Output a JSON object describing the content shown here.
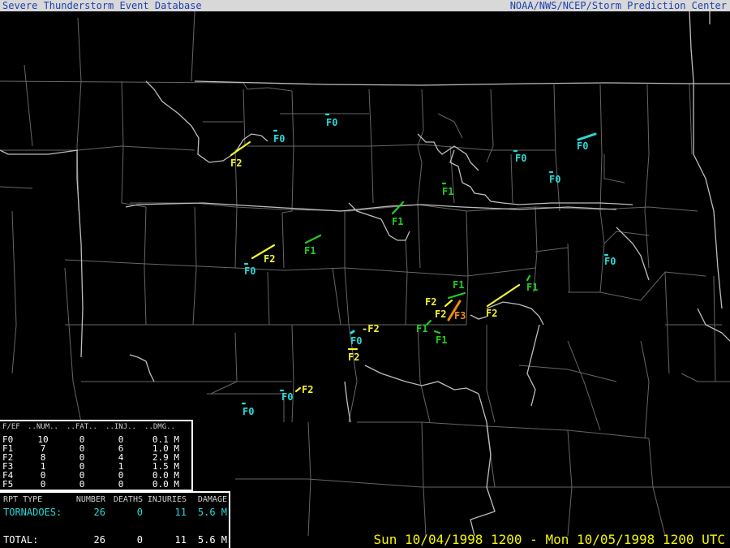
{
  "header": {
    "title_left": "Severe Thunderstorm Event Database",
    "title_right": "NOAA/NWS/NCEP/Storm Prediction Center"
  },
  "colors": {
    "F0": "#29d9d9",
    "F1": "#22cc22",
    "F2": "#f2f230",
    "F3": "#f08a18",
    "border": "#666666",
    "state_line": "#bdbdbd"
  },
  "labels": [
    {
      "text": "F0",
      "class": "F0"
    },
    {
      "text": "F0",
      "class": "F0"
    },
    {
      "text": "F2",
      "class": "F2"
    },
    {
      "text": "F0",
      "class": "F0"
    },
    {
      "text": "F0",
      "class": "F0"
    },
    {
      "text": "F0",
      "class": "F0"
    },
    {
      "text": "F1",
      "class": "F1"
    },
    {
      "text": "F1",
      "class": "F1"
    },
    {
      "text": "F1",
      "class": "F1"
    },
    {
      "text": "F2",
      "class": "F2"
    },
    {
      "text": "F0",
      "class": "F0"
    },
    {
      "text": "F0",
      "class": "F0"
    },
    {
      "text": "F1",
      "class": "F1"
    },
    {
      "text": "F1",
      "class": "F1"
    },
    {
      "text": "F2",
      "class": "F2"
    },
    {
      "text": "F2",
      "class": "F2"
    },
    {
      "text": "F3",
      "class": "F3"
    },
    {
      "text": "F2",
      "class": "F2"
    },
    {
      "text": "F1",
      "class": "F1"
    },
    {
      "text": "F1",
      "class": "F1"
    },
    {
      "text": "-F2",
      "class": "F2"
    },
    {
      "text": "F0",
      "class": "F0"
    },
    {
      "text": "F2",
      "class": "F2"
    },
    {
      "text": "F2",
      "class": "F2"
    },
    {
      "text": "F0",
      "class": "F0"
    },
    {
      "text": "F0",
      "class": "F0"
    }
  ],
  "stats_table": {
    "headers": [
      "F/EF",
      "..NUM..",
      "..FAT..",
      "..INJ..",
      "..DMG.."
    ],
    "rows": [
      [
        "F0",
        "10",
        "0",
        "0",
        "0.1 M"
      ],
      [
        "F1",
        "7",
        "0",
        "6",
        "1.0 M"
      ],
      [
        "F2",
        "8",
        "0",
        "4",
        "2.9 M"
      ],
      [
        "F3",
        "1",
        "0",
        "1",
        "1.5 M"
      ],
      [
        "F4",
        "0",
        "0",
        "0",
        "0.0 M"
      ],
      [
        "F5",
        "0",
        "0",
        "0",
        "0.0 M"
      ]
    ]
  },
  "summary_table": {
    "headers": [
      "RPT TYPE",
      "NUMBER",
      "DEATHS",
      "INJURIES",
      "DAMAGE"
    ],
    "tornadoes": [
      "TORNADOES:",
      "26",
      "0",
      "11",
      "5.6 M"
    ],
    "total": [
      "TOTAL:",
      "26",
      "0",
      "11",
      "5.6 M"
    ]
  },
  "date_range": "Sun 10/04/1998 1200 - Mon 10/05/1998 1200 UTC"
}
